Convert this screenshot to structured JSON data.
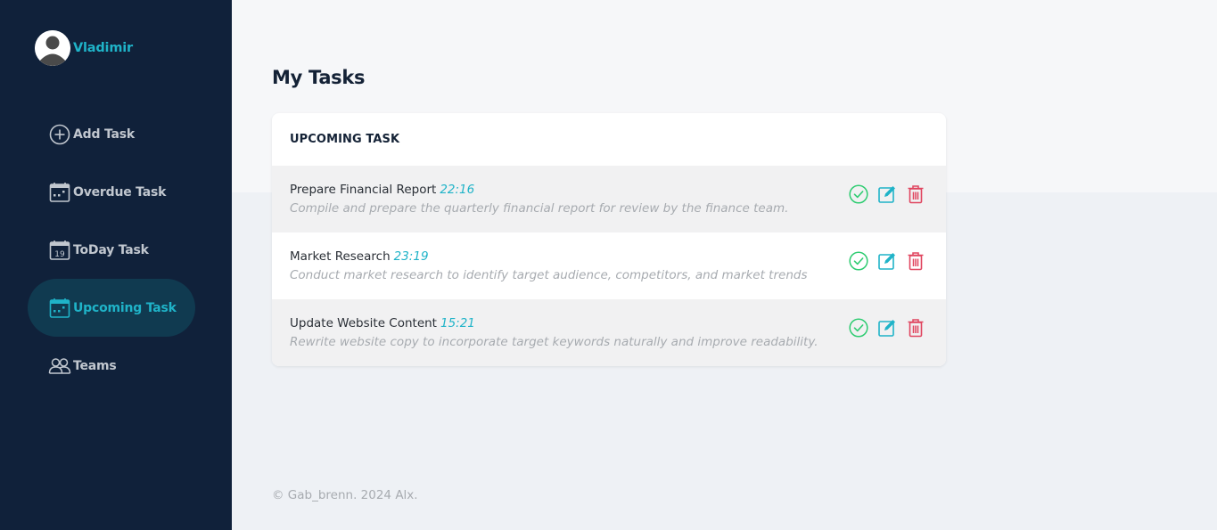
{
  "user": {
    "name": "Vladimir"
  },
  "nav": [
    {
      "label": "Add Task",
      "icon": "plus-circle-icon",
      "active": false
    },
    {
      "label": "Overdue Task",
      "icon": "calendar-icon",
      "active": false
    },
    {
      "label": "ToDay Task",
      "icon": "calendar-day-icon",
      "calendar_day": "19",
      "active": false
    },
    {
      "label": "Upcoming Task",
      "icon": "calendar-icon",
      "active": true
    },
    {
      "label": "Teams",
      "icon": "people-icon",
      "active": false
    }
  ],
  "page": {
    "title": "My Tasks"
  },
  "card": {
    "header": "UPCOMING TASK"
  },
  "tasks": [
    {
      "title": "Prepare Financial Report",
      "time": "22:16",
      "description": "Compile and prepare the quarterly financial report for review by the finance team."
    },
    {
      "title": "Market Research",
      "time": "23:19",
      "description": "Conduct market research to identify target audience, competitors, and market trends"
    },
    {
      "title": "Update Website Content",
      "time": "15:21",
      "description": "Rewrite website copy to incorporate target keywords naturally and improve readability."
    }
  ],
  "footer": {
    "text": "© Gab_brenn. 2024 Alx."
  },
  "colors": {
    "sidebar": "#10213a",
    "accent": "#1fb3c8",
    "complete": "#2ecc71",
    "edit": "#1fb3c8",
    "delete": "#e0455f"
  }
}
